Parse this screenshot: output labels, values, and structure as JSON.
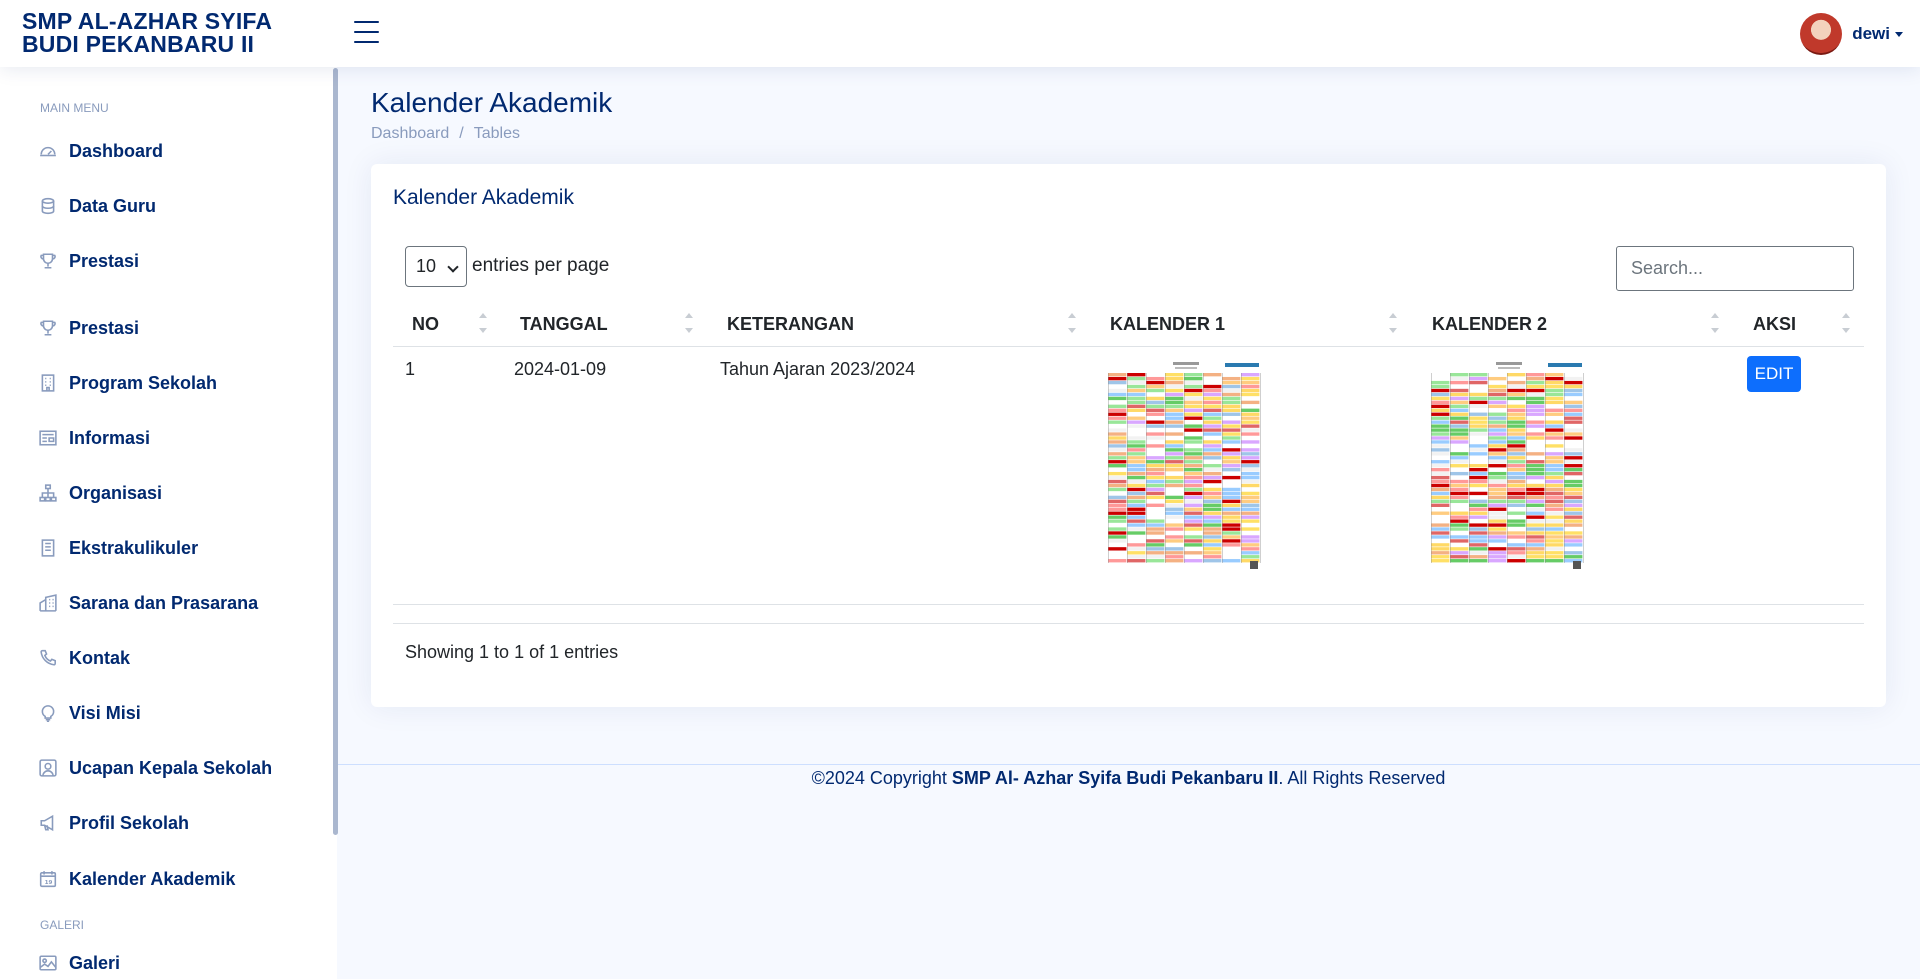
{
  "header": {
    "logo_line1": "SMP AL-AZHAR SYIFA",
    "logo_line2": "BUDI PEKANBARU II",
    "user_name": "dewi"
  },
  "sidebar": {
    "main_heading": "MAIN MENU",
    "gallery_heading": "GALERI",
    "items": [
      {
        "label": "Dashboard",
        "icon": "gauge-icon"
      },
      {
        "label": "Data Guru",
        "icon": "database-icon"
      },
      {
        "label": "Prestasi",
        "icon": "trophy-icon"
      },
      {
        "label": "Prestasi",
        "icon": "trophy-icon"
      },
      {
        "label": "Program Sekolah",
        "icon": "building-icon"
      },
      {
        "label": "Informasi",
        "icon": "newspaper-icon"
      },
      {
        "label": "Organisasi",
        "icon": "diagram-icon"
      },
      {
        "label": "Ekstrakulikuler",
        "icon": "building-icon"
      },
      {
        "label": "Sarana dan Prasarana",
        "icon": "buildings-icon"
      },
      {
        "label": "Kontak",
        "icon": "telephone-icon"
      },
      {
        "label": "Visi Misi",
        "icon": "lightbulb-icon"
      },
      {
        "label": "Ucapan Kepala Sekolah",
        "icon": "person-square-icon"
      },
      {
        "label": "Profil Sekolah",
        "icon": "megaphone-icon"
      },
      {
        "label": "Kalender Akademik",
        "icon": "calendar-icon"
      },
      {
        "label": "Galeri",
        "icon": "image-icon"
      }
    ]
  },
  "page": {
    "title": "Kalender Akademik",
    "breadcrumb": [
      "Dashboard",
      "Tables"
    ]
  },
  "card": {
    "title": "Kalender Akademik",
    "entries_value": "10",
    "entries_label": "entries per page",
    "search_placeholder": "Search...",
    "columns": [
      "NO",
      "TANGGAL",
      "KETERANGAN",
      "KALENDER 1",
      "KALENDER 2",
      "AKSI"
    ],
    "rows": [
      {
        "no": "1",
        "tanggal": "2024-01-09",
        "keterangan": "Tahun Ajaran 2023/2024",
        "aksi": "EDIT"
      }
    ],
    "info": "Showing 1 to 1 of 1 entries"
  },
  "footer": {
    "prefix": "©2024 Copyright ",
    "org": "SMP Al- Azhar Syifa Budi Pekanbaru II",
    "suffix": ". All Rights Reserved"
  }
}
